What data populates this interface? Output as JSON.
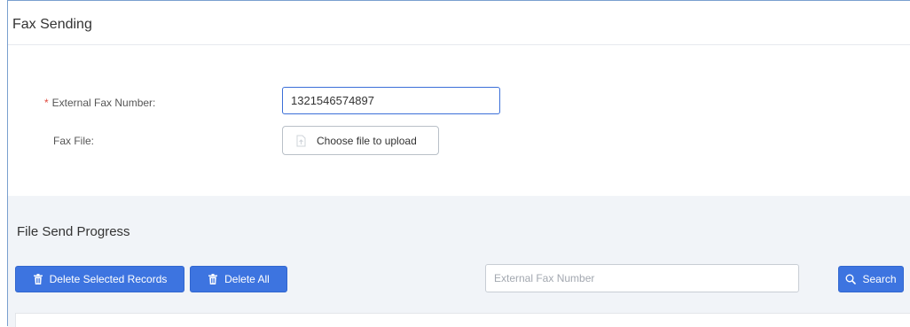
{
  "page": {
    "title": "Fax Sending"
  },
  "form": {
    "external_fax_label": "External Fax Number:",
    "external_fax_value": "1321546574897",
    "fax_file_label": "Fax File:",
    "upload_button_label": "Choose file to upload"
  },
  "progress": {
    "title": "File Send Progress",
    "delete_selected_label": "Delete Selected Records",
    "delete_all_label": "Delete All",
    "search_placeholder": "External Fax Number",
    "search_button_label": "Search"
  },
  "colors": {
    "primary": "#3d74e0",
    "required": "#e04a3f",
    "section_bg": "#f1f4f8"
  },
  "icons": {
    "upload": "upload-icon",
    "trash": "trash-icon",
    "search": "search-icon"
  }
}
